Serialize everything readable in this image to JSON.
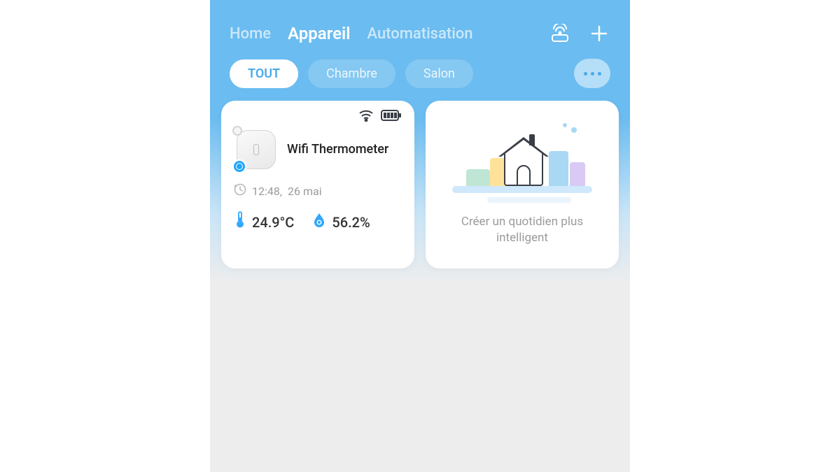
{
  "nav": {
    "home": "Home",
    "appareil": "Appareil",
    "automatisation": "Automatisation"
  },
  "filters": {
    "all": "TOUT",
    "room1": "Chambre",
    "room2": "Salon"
  },
  "device": {
    "name": "Wifi Thermometer",
    "time": "12:48,",
    "date": "26 mai",
    "temperature": "24.9°C",
    "humidity": "56.2%"
  },
  "promo": {
    "text": "Créer un quotidien plus intelligent"
  }
}
